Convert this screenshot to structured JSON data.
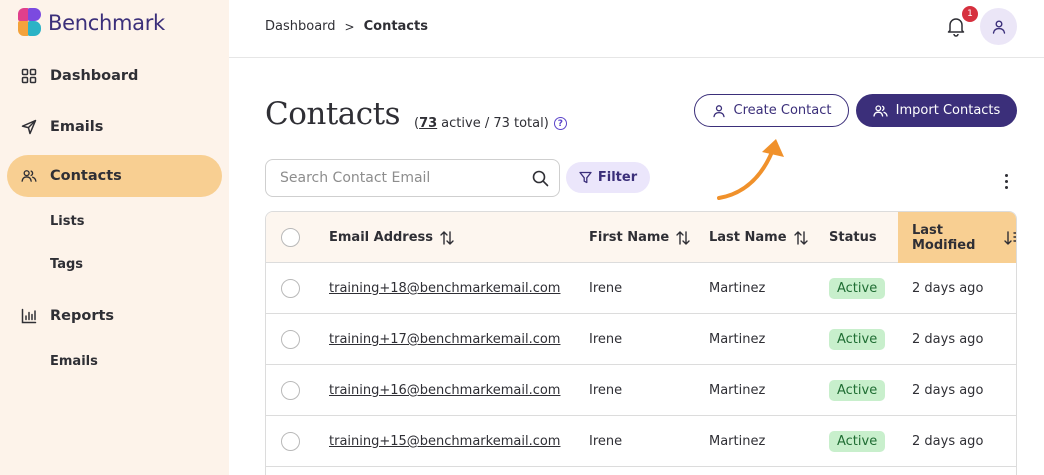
{
  "app": {
    "brand": "Benchmark"
  },
  "sidebar": {
    "items": [
      {
        "label": "Dashboard",
        "icon": "grid-icon"
      },
      {
        "label": "Emails",
        "icon": "send-icon"
      },
      {
        "label": "Contacts",
        "icon": "users-icon",
        "active": true
      },
      {
        "label": "Lists"
      },
      {
        "label": "Tags"
      },
      {
        "label": "Reports",
        "icon": "bar-chart-icon"
      },
      {
        "label": "Emails"
      }
    ]
  },
  "header": {
    "breadcrumb": {
      "root": "Dashboard",
      "separator": ">",
      "current": "Contacts"
    },
    "notifications_count": "1"
  },
  "page": {
    "title": "Contacts",
    "counts_open": "(",
    "active_count": "73",
    "counts_text": "active / 73 total)",
    "help_glyph": "?"
  },
  "actions": {
    "create_label": "Create Contact",
    "import_label": "Import Contacts",
    "filter_label": "Filter"
  },
  "search": {
    "placeholder": "Search Contact Email",
    "value": ""
  },
  "table": {
    "columns": [
      "Email Address",
      "First Name",
      "Last Name",
      "Status",
      "Last Modified"
    ],
    "sorted_column": "Last Modified",
    "rows": [
      {
        "email": "training+18@benchmarkemail.com",
        "first": "Irene",
        "last": "Martinez",
        "status": "Active",
        "modified": "2 days ago"
      },
      {
        "email": "training+17@benchmarkemail.com",
        "first": "Irene",
        "last": "Martinez",
        "status": "Active",
        "modified": "2 days ago"
      },
      {
        "email": "training+16@benchmarkemail.com",
        "first": "Irene",
        "last": "Martinez",
        "status": "Active",
        "modified": "2 days ago"
      },
      {
        "email": "training+15@benchmarkemail.com",
        "first": "Irene",
        "last": "Martinez",
        "status": "Active",
        "modified": "2 days ago"
      }
    ]
  },
  "colors": {
    "brand": "#3b2f7a",
    "sidebar_bg": "#fdf3ea",
    "active_nav": "#f8cf92",
    "status_active_bg": "#c8efcc",
    "annotation_arrow": "#f0912b",
    "badge": "#d6303e"
  }
}
